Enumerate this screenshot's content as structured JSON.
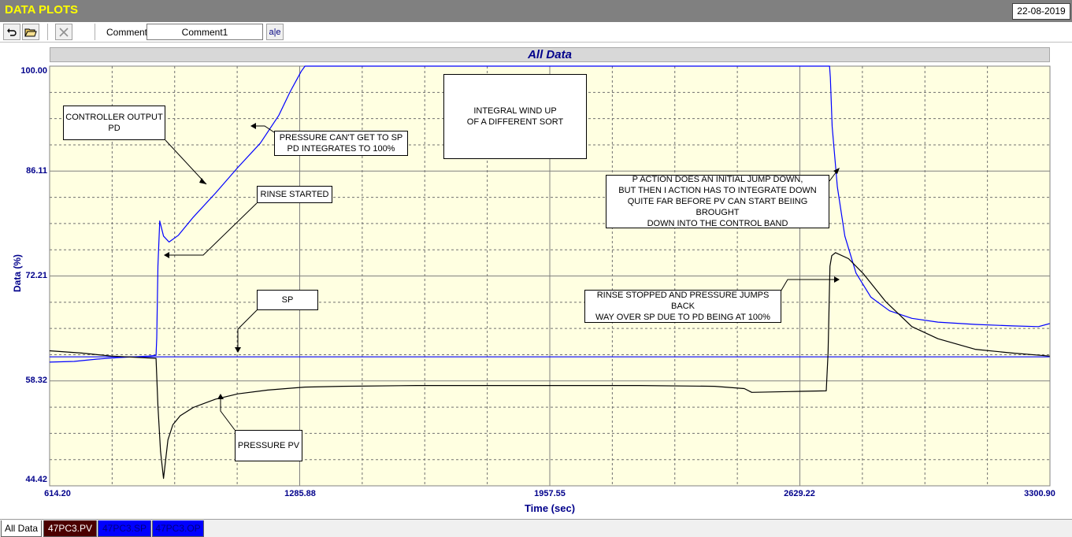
{
  "app": {
    "title": "DATA PLOTS",
    "date": "22-08-2019"
  },
  "toolbar": {
    "undo_icon": "undo-icon",
    "open_icon": "folder-open-icon",
    "delete_icon": "close-icon",
    "comment_label": "Comment",
    "comment_value": "Comment1",
    "spell_button_label": "a|e"
  },
  "tabs": [
    {
      "label": "All Data",
      "bg": "#ffffff",
      "fg": "#000000"
    },
    {
      "label": "47PC3.PV",
      "bg": "#4b0000",
      "fg": "#ffffff"
    },
    {
      "label": "47PC3.SP",
      "bg": "#0000ff",
      "fg": "#000080"
    },
    {
      "label": "47PC3.OP",
      "bg": "#0000ff",
      "fg": "#000080"
    }
  ],
  "colors": {
    "plot_bg": "#ffffe1",
    "axis_text": "#00008b",
    "op_line": "#0000ff",
    "sp_line": "#0000ff",
    "pv_line": "#000000"
  },
  "annotations": {
    "controller_output": "CONTROLLER OUTPUT\nPD",
    "pressure_cant": "PRESSURE CAN'T GET TO SP\nPD INTEGRATES TO 100%",
    "rinse_started": "RINSE STARTED",
    "integral_windup": "INTEGRAL WIND UP\nOF A DIFFERENT SORT",
    "p_action": "P ACTION DOES AN INITIAL JUMP DOWN,\nBUT THEN I ACTION HAS TO INTEGRATE DOWN\nQUITE FAR BEFORE PV CAN START BEIING BROUGHT\nDOWN INTO THE CONTROL BAND",
    "sp": "SP",
    "rinse_stopped": "RINSE STOPPED AND PRESSURE JUMPS BACK\nWAY OVER SP DUE TO PD BEING AT 100%",
    "pressure_pv": "PRESSURE PV"
  },
  "chart_data": {
    "type": "line",
    "title": "All Data",
    "xlabel": "Time (sec)",
    "ylabel": "Data (%)",
    "xlim": [
      614.2,
      3300.9
    ],
    "ylim": [
      44.42,
      100.0
    ],
    "x_ticks": [
      "614.20",
      "1285.88",
      "1957.55",
      "2629.22",
      "3300.90"
    ],
    "y_ticks": [
      "100.00",
      "86.11",
      "72.21",
      "58.32",
      "44.42"
    ],
    "grid": true,
    "series": [
      {
        "name": "47PC3.OP",
        "color": "#0000ff",
        "x": [
          614,
          680,
          740,
          800,
          880,
          900,
          902,
          905,
          910,
          920,
          935,
          960,
          1000,
          1060,
          1120,
          1180,
          1230,
          1260,
          1290,
          1300,
          2400,
          2600,
          2700,
          2709,
          2711,
          2716,
          2730,
          2750,
          2780,
          2820,
          2870,
          2930,
          3000,
          3100,
          3200,
          3270,
          3300
        ],
        "y": [
          60.8,
          60.9,
          61.2,
          61.4,
          61.6,
          61.7,
          64.0,
          73.5,
          79.5,
          77.5,
          76.7,
          77.6,
          80.0,
          83.2,
          86.6,
          89.8,
          93.5,
          96.6,
          99.3,
          100.0,
          100.0,
          100.0,
          100.0,
          100.0,
          98.5,
          92.0,
          84.0,
          77.5,
          72.6,
          69.4,
          67.6,
          66.6,
          66.1,
          65.8,
          65.6,
          65.5,
          65.9
        ]
      },
      {
        "name": "47PC3.SP",
        "color": "#0000ff",
        "x": [
          614,
          3300
        ],
        "y": [
          61.5,
          61.5
        ]
      },
      {
        "name": "47PC3.PV",
        "color": "#000000",
        "x": [
          614,
          700,
          780,
          860,
          900,
          905,
          912,
          920,
          925,
          932,
          945,
          965,
          1000,
          1060,
          1120,
          1200,
          1300,
          1400,
          1600,
          1900,
          2200,
          2400,
          2480,
          2500,
          2600,
          2700,
          2705,
          2710,
          2715,
          2725,
          2760,
          2800,
          2860,
          2930,
          3000,
          3100,
          3200,
          3300
        ],
        "y": [
          62.3,
          62.0,
          61.6,
          61.4,
          61.3,
          55.0,
          49.0,
          45.4,
          47.5,
          50.5,
          52.5,
          53.7,
          54.8,
          55.9,
          56.6,
          57.1,
          57.5,
          57.6,
          57.7,
          57.7,
          57.7,
          57.6,
          57.3,
          56.8,
          56.9,
          57.0,
          62.0,
          73.5,
          74.9,
          75.3,
          74.5,
          72.5,
          68.8,
          65.5,
          63.9,
          62.5,
          62.0,
          61.6
        ]
      }
    ]
  }
}
